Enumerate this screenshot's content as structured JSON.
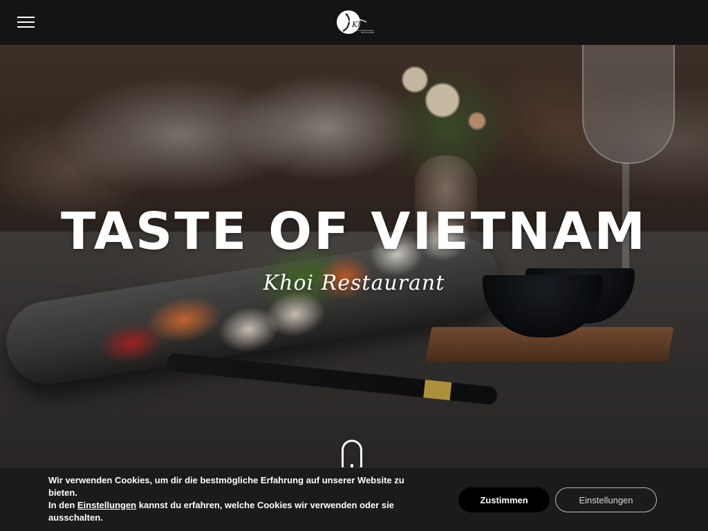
{
  "header": {
    "logo_text": "Khoi",
    "logo_tagline": "RESTAURANT"
  },
  "hero": {
    "title": "TASTE OF VIETNAM",
    "subtitle": "Khoi Restaurant"
  },
  "cookie_banner": {
    "text_line1": "Wir verwenden Cookies, um dir die bestmögliche Erfahrung auf unserer Website zu bieten.",
    "text_line2_prefix": "In den ",
    "text_line2_link": "Einstellungen",
    "text_line2_suffix": " kannst du erfahren, welche Cookies wir verwenden oder sie ausschalten.",
    "accept_label": "Zustimmen",
    "settings_label": "Einstellungen"
  },
  "icons": {
    "menu": "hamburger-icon",
    "scroll": "mouse-scroll-icon"
  },
  "colors": {
    "header_bg": "#141414",
    "cookie_bg": "#1b1b1b",
    "accept_bg": "#000000",
    "text": "#ffffff"
  }
}
